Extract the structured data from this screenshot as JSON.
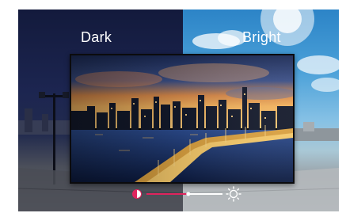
{
  "labels": {
    "dark": "Dark",
    "bright": "Bright"
  },
  "brightness_control": {
    "min_icon": "half-circle-icon",
    "max_icon": "sun-icon",
    "level": 0.55,
    "colors": {
      "accent": "#e0245e",
      "track": "#ffffff"
    }
  },
  "icons": [
    "half-circle-icon",
    "sun-icon"
  ]
}
